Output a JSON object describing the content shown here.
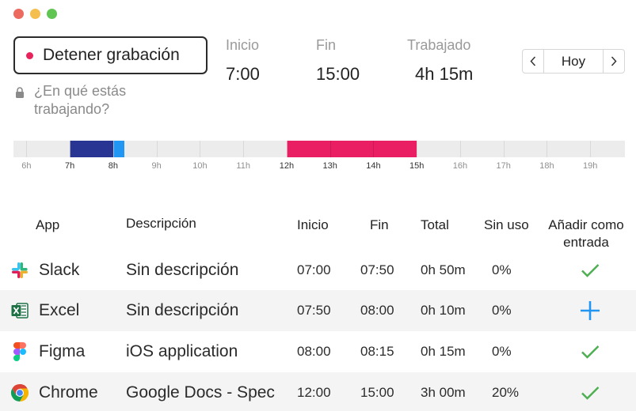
{
  "window": {
    "controls": [
      "close",
      "minimize",
      "maximize"
    ]
  },
  "recording": {
    "button_label": "Detener grabación",
    "dot_color": "#e8235c"
  },
  "task_prompt": "¿En qué estás trabajando?",
  "stats": {
    "start": {
      "label": "Inicio",
      "value": "7:00"
    },
    "end": {
      "label": "Fin",
      "value": "15:00"
    },
    "worked": {
      "label": "Trabajado",
      "value": "4h 15m"
    }
  },
  "day_nav": {
    "label": "Hoy",
    "prev_icon": "chevron-left",
    "next_icon": "chevron-right"
  },
  "timeline": {
    "hours": [
      "6h",
      "7h",
      "8h",
      "9h",
      "10h",
      "11h",
      "12h",
      "13h",
      "14h",
      "15h",
      "16h",
      "17h",
      "18h",
      "19h"
    ],
    "highlighted_hours": [
      "7h",
      "8h",
      "12h",
      "13h",
      "14h",
      "15h"
    ],
    "range_start_hour": 5.7,
    "range_end_hour": 19.8,
    "segments": [
      {
        "from": 7.0,
        "to": 8.0,
        "color": "#283593"
      },
      {
        "from": 8.0,
        "to": 8.25,
        "color": "#2196f3"
      },
      {
        "from": 12.0,
        "to": 15.0,
        "color": "#e91e63"
      }
    ]
  },
  "table": {
    "headers": {
      "app": "App",
      "description": "Descripción",
      "start": "Inicio",
      "end": "Fin",
      "total": "Total",
      "idle": "Sin uso",
      "add": "Añadir como entrada"
    },
    "rows": [
      {
        "icon": "slack-icon",
        "app": "Slack",
        "description": "Sin descripción",
        "start": "07:00",
        "end": "07:50",
        "total": "0h 50m",
        "idle": "0%",
        "action": "check"
      },
      {
        "icon": "excel-icon",
        "app": "Excel",
        "description": "Sin descripción",
        "start": "07:50",
        "end": "08:00",
        "total": "0h 10m",
        "idle": "0%",
        "action": "add"
      },
      {
        "icon": "figma-icon",
        "app": "Figma",
        "description": "iOS application",
        "start": "08:00",
        "end": "08:15",
        "total": "0h 15m",
        "idle": "0%",
        "action": "check"
      },
      {
        "icon": "chrome-icon",
        "app": "Chrome",
        "description": "Google Docs - Spec",
        "start": "12:00",
        "end": "15:00",
        "total": "3h 00m",
        "idle": "20%",
        "action": "check"
      }
    ]
  },
  "colors": {
    "check": "#4caf50",
    "add": "#2196f3"
  }
}
